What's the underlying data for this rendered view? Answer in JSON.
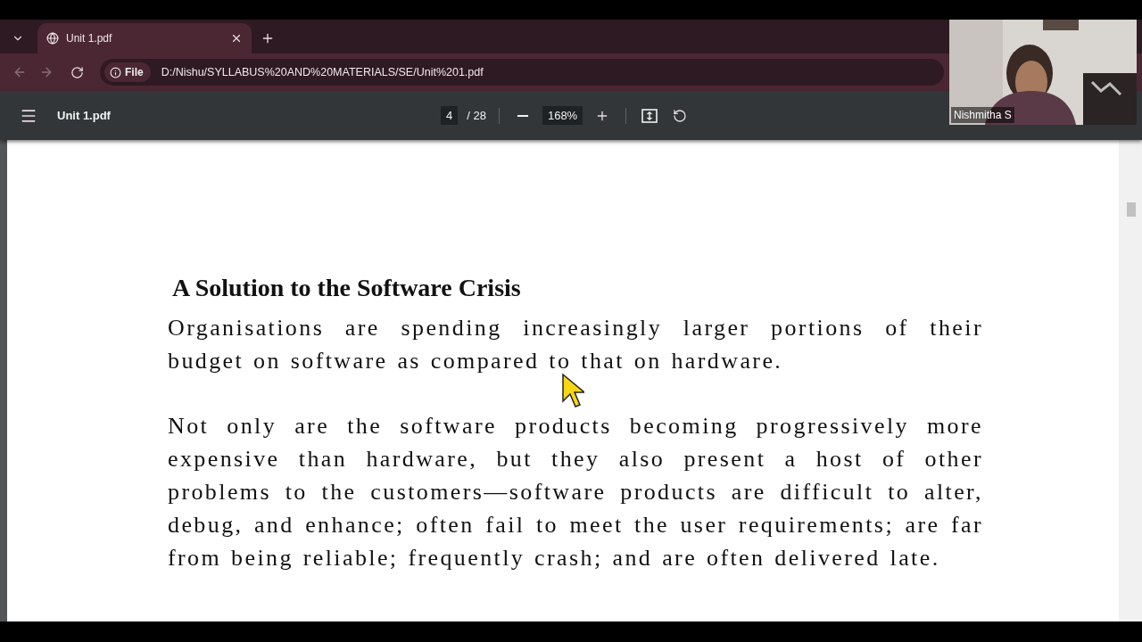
{
  "browser": {
    "tabs": [
      {
        "title": "Unit 1.pdf",
        "selected": true
      }
    ],
    "address": {
      "scheme": "File",
      "url": "D:/Nishu/SYLLABUS%20AND%20MATERIALS/SE/Unit%201.pdf"
    }
  },
  "pdf_toolbar": {
    "title": "Unit 1.pdf",
    "page": "4",
    "page_count": "/ 28",
    "zoom": "168%"
  },
  "document": {
    "heading": "A Solution to the Software Crisis",
    "paragraphs": [
      "Organisations are spending increasingly larger portions of their budget on software as compared to that on hardware.",
      "Not only are the software products becoming progressively more expensive than hardware, but they also present a host of other problems to the customers—software products are difficult to alter, debug, and enhance; often fail to meet the user requirements; are far from being reliable; frequently crash; and are often delivered late."
    ]
  },
  "video_tile": {
    "name": "Nishmitha S"
  }
}
